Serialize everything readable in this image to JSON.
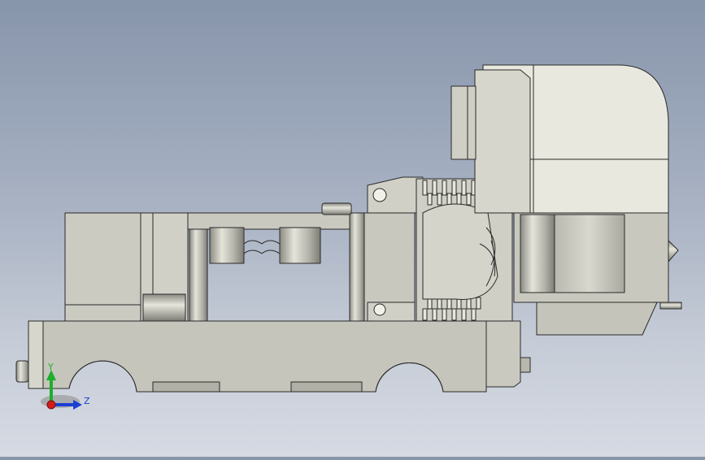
{
  "triad": {
    "y_label": "Y",
    "z_label": "Z",
    "y_color": "#1fae2e",
    "z_color": "#1b3fd1",
    "x_color": "#d31b1b"
  },
  "colors": {
    "background_top": "#8795ab",
    "background_bottom": "#d6dae3",
    "part_fill": "#c8c8bf",
    "part_fill_light": "#e8e8de",
    "part_edge": "#2a2a2a"
  }
}
